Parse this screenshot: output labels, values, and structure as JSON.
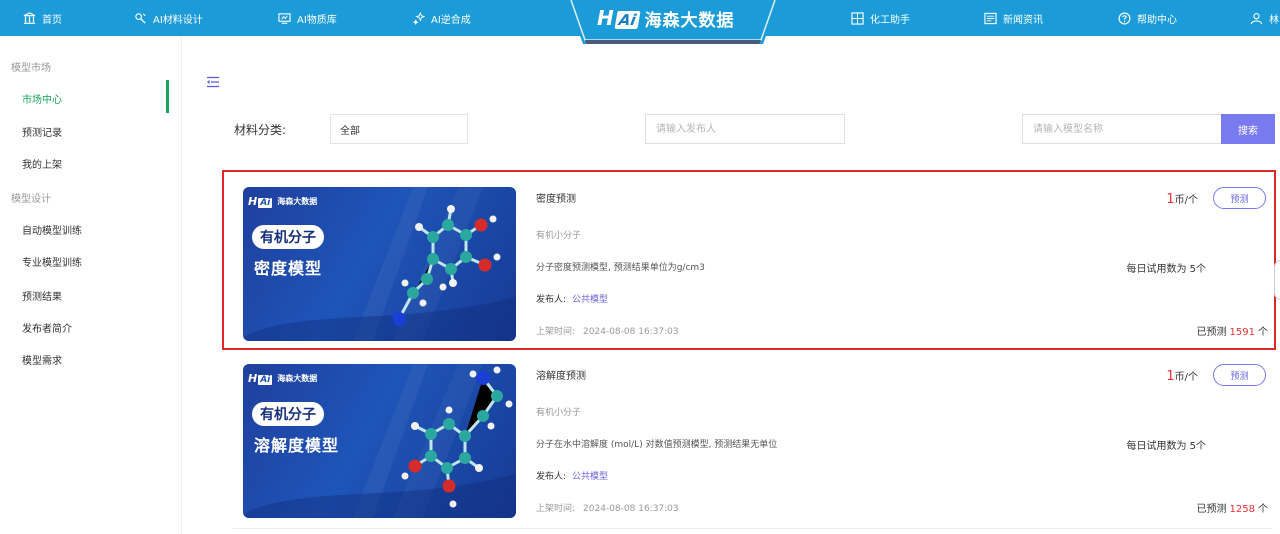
{
  "nav": {
    "home": "首页",
    "material_design": "AI材料设计",
    "library": "AI物质库",
    "synthesis": "AI逆合成",
    "chem_helper": "化工助手",
    "news": "新闻资讯",
    "help": "帮助中心",
    "user": "林"
  },
  "logo": {
    "brand": "H",
    "ai": "Ai",
    "name": "海森大数据"
  },
  "sidebar": {
    "group_market": "模型市场",
    "market_items": [
      "市场中心",
      "预测记录",
      "我的上架"
    ],
    "group_design": "模型设计",
    "design_items": [
      "自动模型训练",
      "专业模型训练",
      "预测结果",
      "发布者简介",
      "模型需求"
    ],
    "active": "市场中心"
  },
  "filter": {
    "label": "材料分类:",
    "category_value": "全部",
    "publisher_placeholder": "请输入发布人",
    "name_placeholder": "请输入模型名称",
    "search_label": "搜索"
  },
  "cards": [
    {
      "thumb_brand_cn": "海森大数据",
      "thumb_pill": "有机分子",
      "thumb_title": "密度模型",
      "title": "密度预测",
      "category": "有机小分子",
      "description": "分子密度预测模型, 预测结果单位为g/cm3",
      "publisher_label": "发布人:",
      "publisher": "公共模型",
      "time_label": "上架时间:",
      "time": "2024-08-08 16:37:03",
      "price": "1",
      "price_unit": "币/个",
      "predict_label": "预测",
      "trial_text": "每日试用数为 5个",
      "count_prefix": "已预测",
      "count": "1591",
      "count_suffix": "个"
    },
    {
      "thumb_brand_cn": "海森大数据",
      "thumb_pill": "有机分子",
      "thumb_title": "溶解度模型",
      "title": "溶解度预测",
      "category": "有机小分子",
      "description": "分子在水中溶解度 (mol/L) 对数值预测模型, 预测结果无单位",
      "publisher_label": "发布人:",
      "publisher": "公共模型",
      "time_label": "上架时间:",
      "time": "2024-08-08 16:37:03",
      "price": "1",
      "price_unit": "币/个",
      "predict_label": "预测",
      "trial_text": "每日试用数为 5个",
      "count_prefix": "已预测",
      "count": "1258",
      "count_suffix": "个"
    }
  ],
  "colors": {
    "nav_bg": "#1b9bd7",
    "active_green": "#19a35d",
    "accent_purple": "#7a7af0",
    "highlight_red": "#e02828"
  }
}
